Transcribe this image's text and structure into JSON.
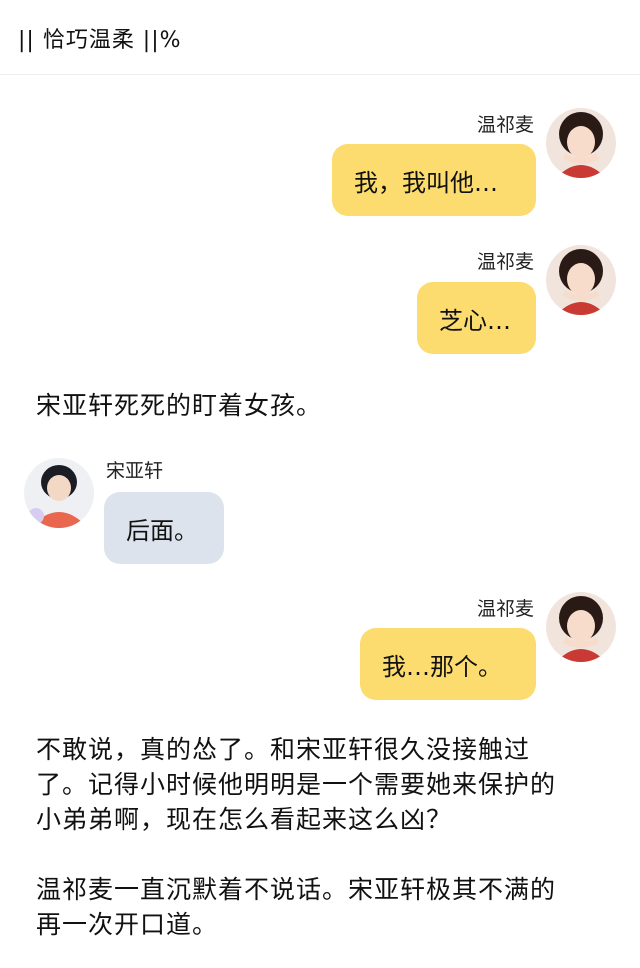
{
  "header": {
    "title": "|| 恰巧温柔 ||%"
  },
  "messages": [
    {
      "speaker": "温祁麦",
      "text": "我，我叫他…",
      "side": "right"
    },
    {
      "speaker": "温祁麦",
      "text": "芝心…",
      "side": "right"
    },
    {
      "speaker": "宋亚轩",
      "text": "后面。",
      "side": "left"
    },
    {
      "speaker": "温祁麦",
      "text": "我…那个。",
      "side": "right"
    }
  ],
  "narration": {
    "line1": "宋亚轩死死的盯着女孩。",
    "para2": [
      "不敢说，真的怂了。和宋亚轩很久没接触过",
      "了。记得小时候他明明是一个需要她来保护的",
      "小弟弟啊，现在怎么看起来这么凶？"
    ],
    "para3": [
      "温祁麦一直沉默着不说话。宋亚轩极其不满的",
      "再一次开口道。"
    ]
  },
  "colors": {
    "right_bubble": "#fcdc6e",
    "left_bubble": "#dde3ec"
  }
}
